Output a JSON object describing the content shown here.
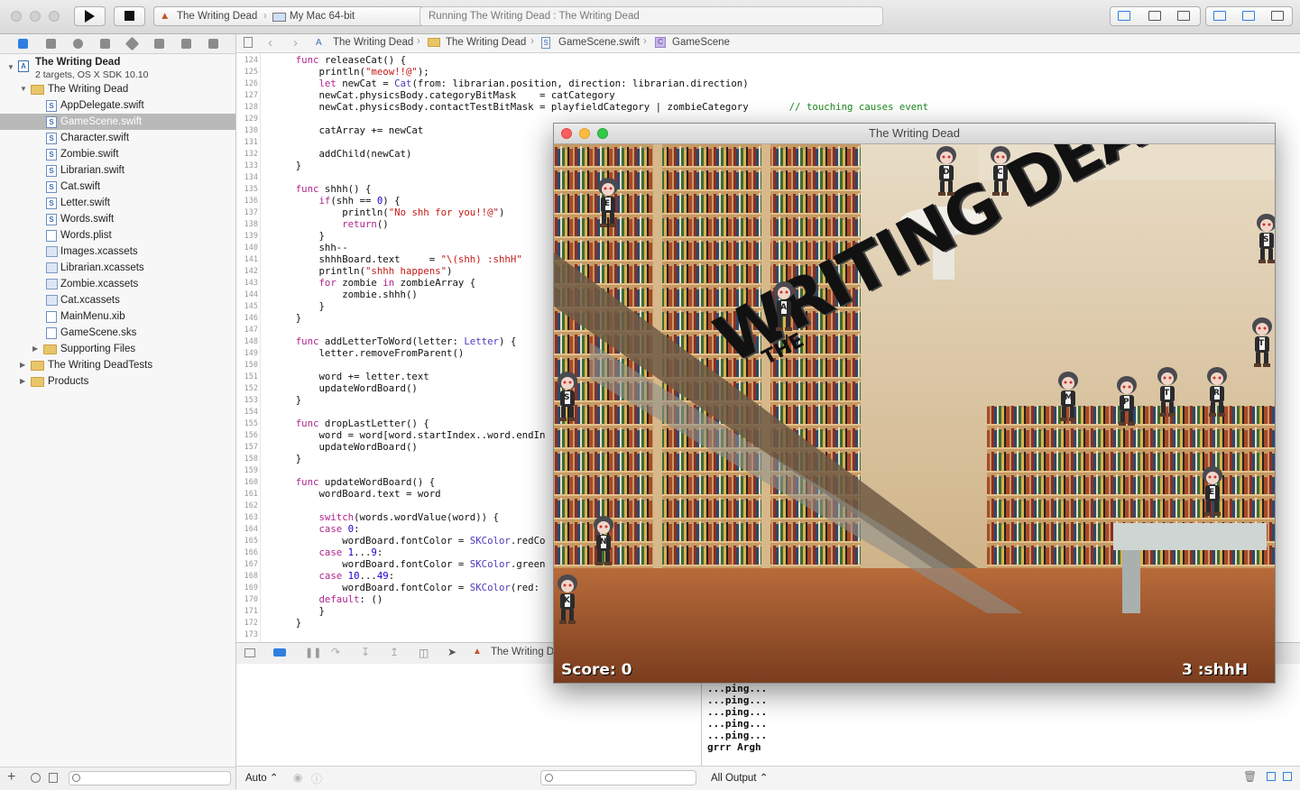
{
  "toolbar": {
    "scheme": "The Writing Dead",
    "destination": "My Mac 64-bit",
    "activity": "Running The Writing Dead : The Writing Dead"
  },
  "navigator": {
    "project": {
      "name": "The Writing Dead",
      "subtitle": "2 targets, OS X SDK 10.10"
    },
    "group": "The Writing Dead",
    "files": [
      {
        "label": "AppDelegate.swift",
        "kind": "swift"
      },
      {
        "label": "GameScene.swift",
        "kind": "swift",
        "selected": true
      },
      {
        "label": "Character.swift",
        "kind": "swift"
      },
      {
        "label": "Zombie.swift",
        "kind": "swift"
      },
      {
        "label": "Librarian.swift",
        "kind": "swift"
      },
      {
        "label": "Cat.swift",
        "kind": "swift"
      },
      {
        "label": "Letter.swift",
        "kind": "swift"
      },
      {
        "label": "Words.swift",
        "kind": "swift"
      },
      {
        "label": "Words.plist",
        "kind": "plist"
      },
      {
        "label": "Images.xcassets",
        "kind": "asset"
      },
      {
        "label": "Librarian.xcassets",
        "kind": "asset"
      },
      {
        "label": "Zombie.xcassets",
        "kind": "asset"
      },
      {
        "label": "Cat.xcassets",
        "kind": "asset"
      },
      {
        "label": "MainMenu.xib",
        "kind": "xib"
      },
      {
        "label": "GameScene.sks",
        "kind": "sks"
      }
    ],
    "supporting": "Supporting Files",
    "tests": "The Writing DeadTests",
    "products": "Products"
  },
  "jumpbar": {
    "items": [
      "The Writing Dead",
      "The Writing Dead",
      "GameScene.swift",
      "GameScene"
    ]
  },
  "editor": {
    "first_line": 124,
    "lines": [
      "    func releaseCat() {",
      "        println(\"meow!!@\");",
      "        let newCat = Cat(from: librarian.position, direction: librarian.direction)",
      "        newCat.physicsBody.categoryBitMask    = catCategory",
      "        newCat.physicsBody.contactTestBitMask = playfieldCategory | zombieCategory       // touching causes event",
      "",
      "        catArray += newCat",
      "",
      "        addChild(newCat)",
      "    }",
      "",
      "    func shhh() {",
      "        if(shh == 0) {",
      "            println(\"No shh for you!!@\")",
      "            return()",
      "        }",
      "        shh--",
      "        shhhBoard.text     = \"\\(shh) :shhH\"",
      "        println(\"shhh happens\")",
      "        for zombie in zombieArray {",
      "            zombie.shhh()",
      "        }",
      "    }",
      "",
      "    func addLetterToWord(letter: Letter) {",
      "        letter.removeFromParent()",
      "",
      "        word += letter.text",
      "        updateWordBoard()",
      "    }",
      "",
      "    func dropLastLetter() {",
      "        word = word[word.startIndex..word.endIn",
      "        updateWordBoard()",
      "    }",
      "",
      "    func updateWordBoard() {",
      "        wordBoard.text = word",
      "",
      "        switch(words.wordValue(word)) {",
      "        case 0:",
      "            wordBoard.fontColor = SKColor.redCo",
      "        case 1...9:",
      "            wordBoard.fontColor = SKColor.green",
      "        case 10...49:",
      "            wordBoard.fontColor = SKColor(red: ",
      "        default: ()",
      "        }",
      "    }",
      ""
    ]
  },
  "debug": {
    "breadcrumb": "The Writing D",
    "console": [
      "...ping...",
      "...ping...",
      "...ping...",
      "...ping...",
      "...ping...",
      "grrr Argh"
    ],
    "auto_label": "Auto ⌃",
    "output_label": "All Output ⌃"
  },
  "game": {
    "window_title": "The Writing Dead",
    "logo_small": "THE",
    "logo_big": "WRITING DEAD",
    "score_label": "Score: 0",
    "shhh_label": "3 :shhH",
    "zombie_letters": [
      "E",
      "D",
      "C",
      "S",
      "A",
      "T",
      "S",
      "M",
      "P",
      "T",
      "R",
      "E",
      "N",
      "K"
    ]
  },
  "colors": {
    "accent": "#2f7fe0",
    "selection": "#b9b9b9",
    "keyword": "#b0248e",
    "string": "#c41a16"
  }
}
